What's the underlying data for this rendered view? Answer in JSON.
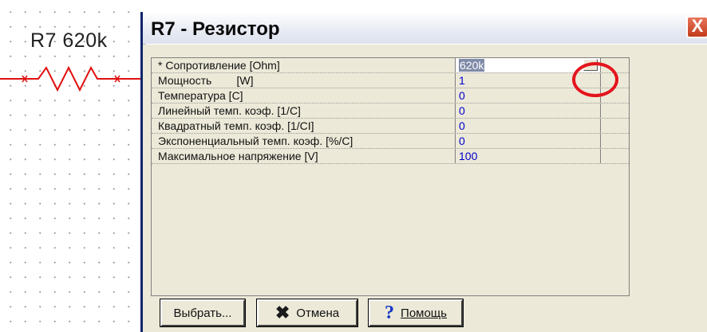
{
  "schematic": {
    "component_label": "R7 620k"
  },
  "dialog": {
    "title": "R7 - Резистор",
    "close_label": "X",
    "properties": [
      {
        "name": "* Сопротивление [Ohm]",
        "value": "620k"
      },
      {
        "name": "Мощность        [W]",
        "value": "1"
      },
      {
        "name": "Температура [C]",
        "value": "0"
      },
      {
        "name": "Линейный темп. коэф. [1/C]",
        "value": "0"
      },
      {
        "name": "Квадратный темп. коэф. [1/CI]",
        "value": "0"
      },
      {
        "name": "Экспоненциальный темп. коэф. [%/C]",
        "value": "0"
      },
      {
        "name": "Максимальное напряжение [V]",
        "value": "100"
      }
    ],
    "ellipsis_label": "...",
    "buttons": {
      "select": "Выбрать...",
      "cancel": "Отмена",
      "help": "Помощь"
    },
    "colors": {
      "value_text": "#0000cc",
      "highlight": "#e4141c"
    }
  }
}
